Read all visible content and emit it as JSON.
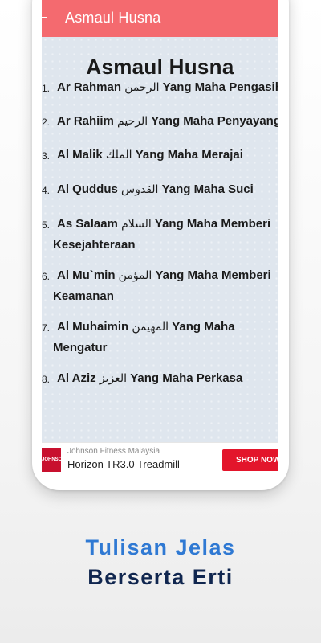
{
  "appbar": {
    "title": "Asmaul Husna",
    "menu_icon": "menu-icon"
  },
  "page": {
    "title": "Asmaul Husna"
  },
  "names": [
    {
      "num": "1.",
      "latin": "Ar Rahman",
      "arabic": "الرحمن",
      "meaning": "Yang Maha Pengasih",
      "meaning_cont": ""
    },
    {
      "num": "2.",
      "latin": "Ar Rahiim",
      "arabic": "الرحيم",
      "meaning": "Yang Maha Penyayang",
      "meaning_cont": ""
    },
    {
      "num": "3.",
      "latin": "Al Malik",
      "arabic": "الملك",
      "meaning": "Yang Maha Merajai",
      "meaning_cont": ""
    },
    {
      "num": "4.",
      "latin": "Al Quddus",
      "arabic": "القدوس",
      "meaning": "Yang Maha Suci",
      "meaning_cont": ""
    },
    {
      "num": "5.",
      "latin": "As Salaam",
      "arabic": "السلام",
      "meaning": "Yang Maha Memberi",
      "meaning_cont": "Kesejahteraan"
    },
    {
      "num": "6.",
      "latin": "Al Mu`min",
      "arabic": "المؤمن",
      "meaning": "Yang Maha Memberi",
      "meaning_cont": "Keamanan"
    },
    {
      "num": "7.",
      "latin": "Al Muhaimin",
      "arabic": "المهيمن",
      "meaning": "Yang Maha",
      "meaning_cont": "Mengatur"
    },
    {
      "num": "8.",
      "latin": "Al Aziz",
      "arabic": "العزيز",
      "meaning": "Yang Maha Perkasa",
      "meaning_cont": ""
    }
  ],
  "ad": {
    "sponsor": "Johnson Fitness Malaysia",
    "product": "Horizon TR3.0 Treadmill",
    "cta": "SHOP NOW",
    "logo_text": "JOHNSON",
    "logo_color": "#c8102e"
  },
  "tagline": {
    "line1": "Tulisan Jelas",
    "line2": "Berserta Erti"
  },
  "colors": {
    "accent": "#f46a6f",
    "tagline_blue": "#2f79d3",
    "tagline_navy": "#10264f"
  }
}
